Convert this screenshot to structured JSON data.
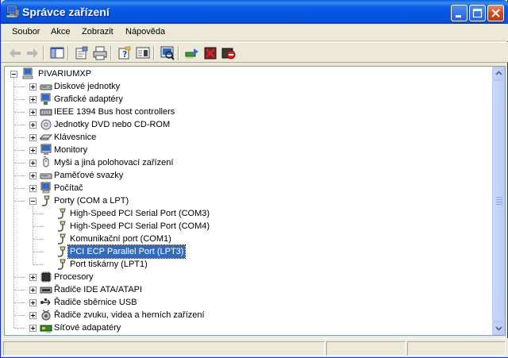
{
  "window": {
    "title": "Správce zařízení"
  },
  "menu": [
    "Soubor",
    "Akce",
    "Zobrazit",
    "Nápověda"
  ],
  "toolbar": [
    "back-arrow-icon",
    "forward-arrow-icon",
    "show-hide-console-tree-icon",
    "properties-icon",
    "print-icon",
    "help-icon",
    "console-view-icon",
    "scan-hardware-icon",
    "update-driver-icon",
    "uninstall-icon",
    "disable-device-icon"
  ],
  "tree": {
    "root": "PIVARIUMXP",
    "nodes": [
      {
        "label": "Diskové jednotky",
        "icon": "disk-drive-icon",
        "level": 1,
        "state": "collapsed"
      },
      {
        "label": "Grafické adaptéry",
        "icon": "display-adapter-icon",
        "level": 1,
        "state": "collapsed"
      },
      {
        "label": "IEEE 1394 Bus host controllers",
        "icon": "ieee1394-icon",
        "level": 1,
        "state": "collapsed"
      },
      {
        "label": "Jednotky DVD nebo CD-ROM",
        "icon": "dvd-drive-icon",
        "level": 1,
        "state": "collapsed"
      },
      {
        "label": "Klávesnice",
        "icon": "keyboard-icon",
        "level": 1,
        "state": "collapsed"
      },
      {
        "label": "Monitory",
        "icon": "monitor-icon",
        "level": 1,
        "state": "collapsed"
      },
      {
        "label": "Myši a jiná polohovací zařízení",
        "icon": "mouse-icon",
        "level": 1,
        "state": "collapsed"
      },
      {
        "label": "Paměťové svazky",
        "icon": "storage-volume-icon",
        "level": 1,
        "state": "collapsed"
      },
      {
        "label": "Počítač",
        "icon": "computer-icon",
        "level": 1,
        "state": "collapsed"
      },
      {
        "label": "Porty (COM a LPT)",
        "icon": "port-icon",
        "level": 1,
        "state": "expanded"
      },
      {
        "label": "High-Speed PCI Serial Port (COM3)",
        "icon": "port-icon",
        "level": 2,
        "state": "leaf"
      },
      {
        "label": "High-Speed PCI Serial Port (COM4)",
        "icon": "port-icon",
        "level": 2,
        "state": "leaf"
      },
      {
        "label": "Komunikační port (COM1)",
        "icon": "port-icon",
        "level": 2,
        "state": "leaf"
      },
      {
        "label": "PCI ECP Parallel Port (LPT3)",
        "icon": "port-icon",
        "level": 2,
        "state": "leaf",
        "selected": true
      },
      {
        "label": "Port tiskárny (LPT1)",
        "icon": "port-icon",
        "level": 2,
        "state": "leaf"
      },
      {
        "label": "Procesory",
        "icon": "processor-icon",
        "level": 1,
        "state": "collapsed"
      },
      {
        "label": "Řadiče IDE ATA/ATAPI",
        "icon": "ide-controller-icon",
        "level": 1,
        "state": "collapsed"
      },
      {
        "label": "Řadiče sběrnice USB",
        "icon": "usb-icon",
        "level": 1,
        "state": "collapsed"
      },
      {
        "label": "Řadiče zvuku, videa a herních zařízení",
        "icon": "sound-icon",
        "level": 1,
        "state": "collapsed"
      },
      {
        "label": "Síťové adapatéry",
        "icon": "network-adapter-icon",
        "level": 1,
        "state": "collapsed"
      }
    ]
  },
  "colors": {
    "titlebar": "#0454de",
    "selection": "#316ac5",
    "face": "#ece9d8"
  }
}
